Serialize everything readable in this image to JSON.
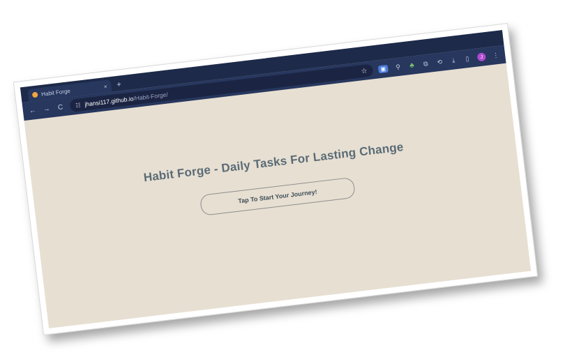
{
  "browser": {
    "tab_title": "Habit Forge",
    "tab_close": "×",
    "new_tab": "+",
    "back": "←",
    "forward": "→",
    "reload": "C",
    "url_host": "jhansi117.github.io",
    "url_path": "/Habit-Forge/",
    "avatar_initial": "J"
  },
  "icons": {
    "bookmark": "star-icon",
    "site_info": "tune-icon",
    "extensions": "puzzle-icon",
    "download": "download-icon",
    "sidepanel": "sidepanel-icon",
    "menu": "menu-icon"
  },
  "page": {
    "title": "Habit Forge - Daily Tasks For Lasting Change",
    "start_button": "Tap To Start Your Journey!"
  },
  "colors": {
    "background": "#e7dfd2",
    "title": "#5a6b76",
    "chrome": "#27375e"
  }
}
